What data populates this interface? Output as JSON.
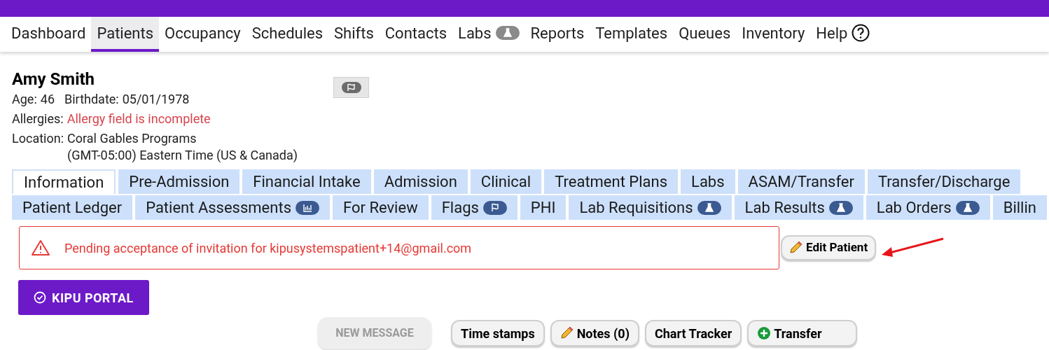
{
  "nav": [
    {
      "label": "Dashboard",
      "selected": false
    },
    {
      "label": "Patients",
      "selected": true
    },
    {
      "label": "Occupancy",
      "selected": false
    },
    {
      "label": "Schedules",
      "selected": false
    },
    {
      "label": "Shifts",
      "selected": false
    },
    {
      "label": "Contacts",
      "selected": false
    },
    {
      "label": "Labs",
      "selected": false,
      "kind": "flask"
    },
    {
      "label": "Reports",
      "selected": false
    },
    {
      "label": "Templates",
      "selected": false
    },
    {
      "label": "Queues",
      "selected": false
    },
    {
      "label": "Inventory",
      "selected": false
    },
    {
      "label": "Help",
      "selected": false,
      "kind": "help"
    }
  ],
  "patient": {
    "name": "Amy Smith",
    "age_label": "Age:",
    "age": "46",
    "birthdate_label": "Birthdate:",
    "birthdate": "05/01/1978",
    "allergies_label": "Allergies:",
    "allergies": "Allergy field is incomplete",
    "location_label": "Location:",
    "location": "Coral Gables Programs",
    "timezone": "(GMT-05:00) Eastern Time (US & Canada)"
  },
  "tab_rows": [
    [
      {
        "label": "Information",
        "selected": true
      },
      {
        "label": "Pre-Admission",
        "selected": false
      },
      {
        "label": "Financial Intake",
        "selected": false
      },
      {
        "label": "Admission",
        "selected": false
      },
      {
        "label": "Clinical",
        "selected": false
      },
      {
        "label": "Treatment Plans",
        "selected": false
      },
      {
        "label": "Labs",
        "selected": false
      },
      {
        "label": "ASAM/Transfer",
        "selected": false
      },
      {
        "label": "Transfer/Discharge",
        "selected": false
      }
    ],
    [
      {
        "label": "Patient Ledger",
        "selected": false
      },
      {
        "label": "Patient Assessments",
        "selected": false,
        "kind": "chart"
      },
      {
        "label": "For Review",
        "selected": false
      },
      {
        "label": "Flags",
        "selected": false,
        "kind": "flag"
      },
      {
        "label": "PHI",
        "selected": false
      },
      {
        "label": "Lab Requisitions",
        "selected": false,
        "kind": "flask"
      },
      {
        "label": "Lab Results",
        "selected": false,
        "kind": "flask"
      },
      {
        "label": "Lab Orders",
        "selected": false,
        "kind": "flask"
      },
      {
        "label": "Billin",
        "selected": false
      }
    ]
  ],
  "alert": "Pending acceptance of invitation for kipusystemspatient+14@gmail.com",
  "edit_button": "Edit Patient",
  "portal_button": "KIPU PORTAL",
  "actions": [
    {
      "label": "NEW MESSAGE",
      "disabled": true
    },
    {
      "label": "Time stamps",
      "disabled": false
    },
    {
      "label": "Notes (0)",
      "disabled": false,
      "kind": "pencil"
    },
    {
      "label": "Chart Tracker",
      "disabled": false
    },
    {
      "label": "Transfer",
      "disabled": false,
      "kind": "plus"
    }
  ]
}
